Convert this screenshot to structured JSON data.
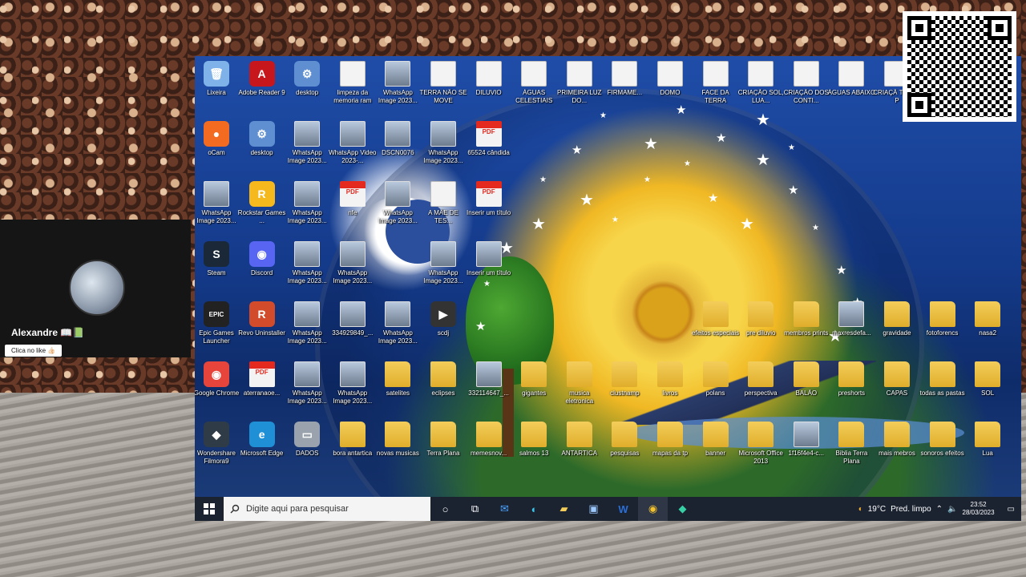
{
  "webcam": {
    "name": "Alexandre 📖📗",
    "like_label": "Clica no like 👍🏻"
  },
  "desktop_icons": [
    {
      "label": "Lixeira",
      "kind": "bin",
      "col": 0,
      "row": 0
    },
    {
      "label": "Adobe Reader 9",
      "kind": "adobe",
      "col": 1,
      "row": 0
    },
    {
      "label": "desktop",
      "kind": "gear",
      "col": 2,
      "row": 0
    },
    {
      "label": "limpeza da memoria ram",
      "kind": "doc",
      "col": 3,
      "row": 0
    },
    {
      "label": "WhatsApp Image 2023...",
      "kind": "img",
      "col": 4,
      "row": 0
    },
    {
      "label": "TERRA NÃO SE MOVE",
      "kind": "doc",
      "col": 5,
      "row": 0
    },
    {
      "label": "DILUVIO",
      "kind": "doc",
      "col": 6,
      "row": 0
    },
    {
      "label": "ÁGUAS CELESTIAIS",
      "kind": "doc",
      "col": 7,
      "row": 0
    },
    {
      "label": "PRIMEIRA LUZ DO...",
      "kind": "doc",
      "col": 8,
      "row": 0
    },
    {
      "label": "FIRMAME...",
      "kind": "doc",
      "col": 9,
      "row": 0
    },
    {
      "label": "DOMO",
      "kind": "doc",
      "col": 10,
      "row": 0
    },
    {
      "label": "FACE DA TERRA",
      "kind": "doc",
      "col": 11,
      "row": 0
    },
    {
      "label": "CRIAÇÃO SOL, LUA...",
      "kind": "doc",
      "col": 12,
      "row": 0
    },
    {
      "label": "CRIAÇÃO DOS CONTI...",
      "kind": "doc",
      "col": 13,
      "row": 0
    },
    {
      "label": "ÁGUAS ABAIXO",
      "kind": "doc",
      "col": 14,
      "row": 0
    },
    {
      "label": "CRIAÇÃ TERRA P",
      "kind": "doc",
      "col": 15,
      "row": 0
    },
    {
      "label": "oCam",
      "kind": "ocam",
      "col": 0,
      "row": 1
    },
    {
      "label": "desktop",
      "kind": "gear",
      "col": 1,
      "row": 1
    },
    {
      "label": "WhatsApp Image 2023...",
      "kind": "img",
      "col": 2,
      "row": 1
    },
    {
      "label": "WhatsApp Video 2023-...",
      "kind": "img",
      "col": 3,
      "row": 1
    },
    {
      "label": "DSCN0076",
      "kind": "img",
      "col": 4,
      "row": 1
    },
    {
      "label": "WhatsApp Image 2023...",
      "kind": "img",
      "col": 5,
      "row": 1
    },
    {
      "label": "65524 cândida",
      "kind": "pdf",
      "col": 6,
      "row": 1
    },
    {
      "label": "WhatsApp Image 2023...",
      "kind": "img",
      "col": 0,
      "row": 2
    },
    {
      "label": "Rockstar Games ...",
      "kind": "rockstar",
      "col": 1,
      "row": 2
    },
    {
      "label": "WhatsApp Image 2023...",
      "kind": "img",
      "col": 2,
      "row": 2
    },
    {
      "label": "nfe",
      "kind": "pdf",
      "col": 3,
      "row": 2
    },
    {
      "label": "WhatsApp Image 2023...",
      "kind": "img",
      "col": 4,
      "row": 2
    },
    {
      "label": "A MÃE DE TES...",
      "kind": "doc",
      "col": 5,
      "row": 2
    },
    {
      "label": "Inserir um título",
      "kind": "pdf",
      "col": 6,
      "row": 2
    },
    {
      "label": "Steam",
      "kind": "steam",
      "col": 0,
      "row": 3
    },
    {
      "label": "Discord",
      "kind": "discord",
      "col": 1,
      "row": 3
    },
    {
      "label": "WhatsApp Image 2023...",
      "kind": "img",
      "col": 2,
      "row": 3
    },
    {
      "label": "WhatsApp Image 2023...",
      "kind": "img",
      "col": 3,
      "row": 3
    },
    {
      "label": "WhatsApp Image 2023...",
      "kind": "img",
      "col": 5,
      "row": 3
    },
    {
      "label": "Inserir um título",
      "kind": "img",
      "col": 6,
      "row": 3
    },
    {
      "label": "Epic Games Launcher",
      "kind": "epic",
      "col": 0,
      "row": 4
    },
    {
      "label": "Revo Uninstaller",
      "kind": "revo",
      "col": 1,
      "row": 4
    },
    {
      "label": "WhatsApp Image 2023...",
      "kind": "img",
      "col": 2,
      "row": 4
    },
    {
      "label": "334929849_...",
      "kind": "img",
      "col": 3,
      "row": 4
    },
    {
      "label": "WhatsApp Image 2023...",
      "kind": "img",
      "col": 4,
      "row": 4
    },
    {
      "label": "scdj",
      "kind": "media",
      "col": 5,
      "row": 4
    },
    {
      "label": "efeitos especiais",
      "kind": "folder",
      "col": 11,
      "row": 4
    },
    {
      "label": "pre diluvio",
      "kind": "folder",
      "col": 12,
      "row": 4
    },
    {
      "label": "membros prints",
      "kind": "folder",
      "col": 13,
      "row": 4
    },
    {
      "label": "maxresdefa...",
      "kind": "img",
      "col": 14,
      "row": 4
    },
    {
      "label": "gravidade",
      "kind": "folder",
      "col": 15,
      "row": 4
    },
    {
      "label": "fotoforencs",
      "kind": "folder",
      "col": 16,
      "row": 4
    },
    {
      "label": "nasa2",
      "kind": "folder",
      "col": 17,
      "row": 4
    },
    {
      "label": "Google Chrome",
      "kind": "chrome",
      "col": 0,
      "row": 5
    },
    {
      "label": "aterranaoe...",
      "kind": "pdf",
      "col": 1,
      "row": 5
    },
    {
      "label": "WhatsApp Image 2023...",
      "kind": "img",
      "col": 2,
      "row": 5
    },
    {
      "label": "WhatsApp Image 2023...",
      "kind": "img",
      "col": 3,
      "row": 5
    },
    {
      "label": "satelites",
      "kind": "folder",
      "col": 4,
      "row": 5
    },
    {
      "label": "eclipses",
      "kind": "folder",
      "col": 5,
      "row": 5
    },
    {
      "label": "332114647_...",
      "kind": "img",
      "col": 6,
      "row": 5
    },
    {
      "label": "gigantes",
      "kind": "folder",
      "col": 7,
      "row": 5
    },
    {
      "label": "musica eletronica",
      "kind": "folder",
      "col": 8,
      "row": 5
    },
    {
      "label": "clustnamp",
      "kind": "folder",
      "col": 9,
      "row": 5
    },
    {
      "label": "livros",
      "kind": "folder",
      "col": 10,
      "row": 5
    },
    {
      "label": "polans",
      "kind": "folder",
      "col": 11,
      "row": 5
    },
    {
      "label": "perspectiva",
      "kind": "folder",
      "col": 12,
      "row": 5
    },
    {
      "label": "BALÃO",
      "kind": "folder",
      "col": 13,
      "row": 5
    },
    {
      "label": "preshorts",
      "kind": "folder",
      "col": 14,
      "row": 5
    },
    {
      "label": "CAPAS",
      "kind": "folder",
      "col": 15,
      "row": 5
    },
    {
      "label": "todas as pastas",
      "kind": "folder",
      "col": 16,
      "row": 5
    },
    {
      "label": "SOL",
      "kind": "folder",
      "col": 17,
      "row": 5
    },
    {
      "label": "Wondershare Filmora9",
      "kind": "filmora",
      "col": 0,
      "row": 6
    },
    {
      "label": "Microsoft Edge",
      "kind": "edge",
      "col": 1,
      "row": 6
    },
    {
      "label": "DADOS",
      "kind": "drive",
      "col": 2,
      "row": 6
    },
    {
      "label": "bora antartica",
      "kind": "folder",
      "col": 3,
      "row": 6
    },
    {
      "label": "novas musicas",
      "kind": "folder",
      "col": 4,
      "row": 6
    },
    {
      "label": "Terra Plana",
      "kind": "folder",
      "col": 5,
      "row": 6
    },
    {
      "label": "memesnov...",
      "kind": "folder",
      "col": 6,
      "row": 6
    },
    {
      "label": "salmos 13",
      "kind": "folder",
      "col": 7,
      "row": 6
    },
    {
      "label": "ANTARTICA",
      "kind": "folder",
      "col": 8,
      "row": 6
    },
    {
      "label": "pesquisas",
      "kind": "folder",
      "col": 9,
      "row": 6
    },
    {
      "label": "mapas da tp",
      "kind": "folder",
      "col": 10,
      "row": 6
    },
    {
      "label": "banner",
      "kind": "folder",
      "col": 11,
      "row": 6
    },
    {
      "label": "Microsoft Office 2013",
      "kind": "folder",
      "col": 12,
      "row": 6
    },
    {
      "label": "1f16f4e4-c...",
      "kind": "img",
      "col": 13,
      "row": 6
    },
    {
      "label": "Biblia Terra Plana",
      "kind": "folder",
      "col": 14,
      "row": 6
    },
    {
      "label": "mais mebros",
      "kind": "folder",
      "col": 15,
      "row": 6
    },
    {
      "label": "sonoros efeitos",
      "kind": "folder",
      "col": 16,
      "row": 6
    },
    {
      "label": "Lua",
      "kind": "folder",
      "col": 17,
      "row": 6
    }
  ],
  "taskbar": {
    "search_placeholder": "Digite aqui para pesquisar",
    "weather_temp": "19°C",
    "weather_text": "Pred. limpo",
    "time": "23:52",
    "date": "28/03/2023"
  },
  "colors": {
    "taskbar_bg": "#1b2230",
    "sky_blue": "#1f4da8",
    "sun_yellow": "#f7d54a",
    "pdf_red": "#e42a1f",
    "folder_yellow": "#f3cd5a"
  }
}
